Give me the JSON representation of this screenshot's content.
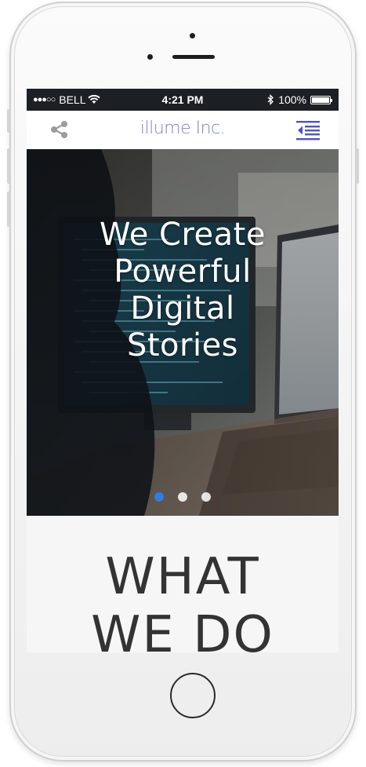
{
  "status_bar": {
    "signal": "●●●○○",
    "carrier": "BELL",
    "time": "4:21 PM",
    "battery": "100%"
  },
  "nav": {
    "brand": "illume Inc.",
    "share_icon": "share-icon",
    "menu_icon": "indent-menu-icon",
    "accent_color": "#7b7fd6"
  },
  "hero": {
    "title_lines": [
      "We Create",
      "Powerful",
      "Digital",
      "Stories"
    ],
    "slides": 3,
    "active_slide": 1,
    "active_dot_color": "#2f7de1"
  },
  "section": {
    "title_lines": [
      "WHAT",
      "WE DO"
    ]
  }
}
